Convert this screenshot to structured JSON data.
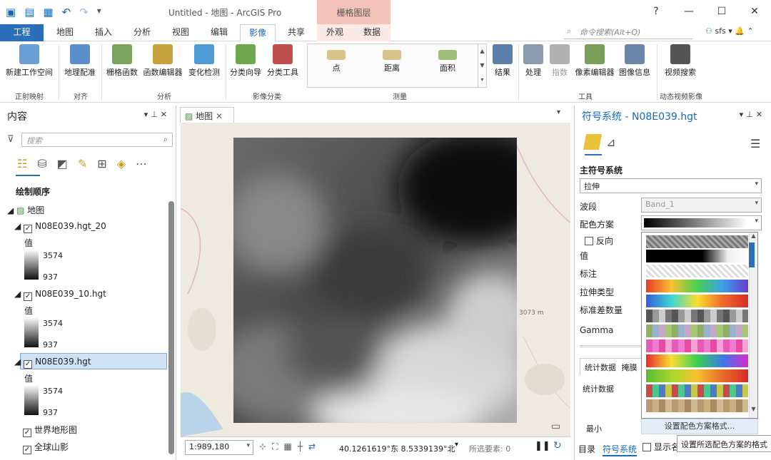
{
  "title_bar": {
    "title": "Untitled - 地图 - ArcGIS Pro",
    "context_group": "栅格图层",
    "win_controls": [
      "?",
      "—",
      "☐",
      "✕"
    ]
  },
  "tabs": [
    "工程",
    "地图",
    "插入",
    "分析",
    "视图",
    "编辑",
    "影像",
    "共享"
  ],
  "context_tabs": [
    "外观",
    "数据"
  ],
  "command_search": {
    "placeholder": "命令搜索(Alt+Q)"
  },
  "user": {
    "name": "sfs"
  },
  "ribbon": {
    "buttons": [
      {
        "label": "新建工作空间",
        "color": "#6a9fd4"
      },
      {
        "label": "地理配准",
        "color": "#5b8fcb"
      },
      {
        "label": "栅格函数",
        "color": "#7aa35b"
      },
      {
        "label": "函数编辑器",
        "color": "#c6a23a"
      },
      {
        "label": "变化检测",
        "color": "#4e9ad4"
      },
      {
        "label": "分类向导",
        "color": "#6fa84f"
      },
      {
        "label": "分类工具",
        "color": "#c0504d"
      },
      {
        "label": "结果",
        "color": "#5a7fa8"
      },
      {
        "label": "处理",
        "color": "#8a9bb0"
      },
      {
        "label": "指数",
        "color": "#b0b0b0"
      },
      {
        "label": "像素编辑器",
        "color": "#7a9f5b"
      },
      {
        "label": "图像信息",
        "color": "#6b86a8"
      },
      {
        "label": "视频搜索",
        "color": "#555555"
      }
    ],
    "gallery": [
      "点",
      "距离",
      "面积"
    ],
    "groups": [
      "正射映射",
      "对齐",
      "分析",
      "影像分类",
      "测量",
      "工具",
      "动态视频影像"
    ]
  },
  "contents": {
    "title": "内容",
    "search_placeholder": "搜索",
    "draw_order": "绘制顺序",
    "map_label": "地图",
    "value_label": "值",
    "layers": [
      {
        "name": "N08E039.hgt_20",
        "max": "3574",
        "min": "937"
      },
      {
        "name": "N08E039_10.hgt",
        "max": "3574",
        "min": "937"
      },
      {
        "name": "N08E039.hgt",
        "max": "3574",
        "min": "937"
      }
    ],
    "base_layers": [
      "世界地形图",
      "全球山影"
    ]
  },
  "map": {
    "tab_label": "地图",
    "scale": "1:989,180",
    "coords": "40.1261619°东 8.5339139°北",
    "selected": "所选要素: 0",
    "elevation_label": "3073 m"
  },
  "symbology": {
    "title": "符号系统 - N08E039.hgt",
    "primary": "主符号系统",
    "renderer": "拉伸",
    "band_label": "波段",
    "band_value": "Band_1",
    "scheme_label": "配色方案",
    "invert_label": "反向",
    "labels": [
      "值",
      "标注",
      "拉伸类型",
      "标准差数量",
      "Gamma"
    ],
    "tabs": [
      "统计数据",
      "掩膜"
    ],
    "stats_label": "统计数据",
    "min_label": "最小",
    "format_button": "设置配色方案格式...",
    "tooltip": "设置所选配色方案的格式",
    "show_label": "显示名",
    "bottom_tabs": [
      "目录",
      "符号系统"
    ]
  }
}
